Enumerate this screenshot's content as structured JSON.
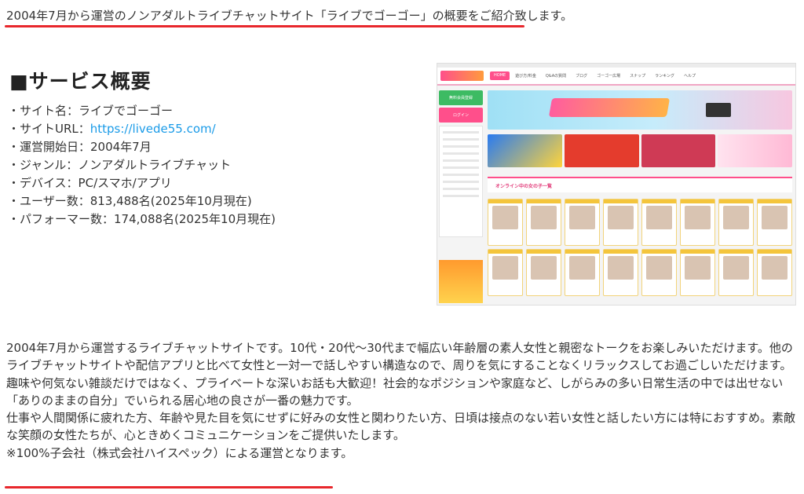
{
  "intro_text": "2004年7月から運営のノンアダルトライブチャットサイト「ライブでゴーゴー」の概要をご紹介致します。",
  "accent_color": "#e8272c",
  "link_color": "#1a9be8",
  "section_heading": "■サービス概要",
  "info": {
    "site_name": "・サイト名：ライブでゴーゴー",
    "site_url_label": "・サイトURL：",
    "site_url": "https://livede55.com/",
    "start_date": "・運営開始日：2004年7月",
    "genre": "・ジャンル：ノンアダルトライブチャット",
    "device": "・デバイス：PC/スマホ/アプリ",
    "users": "・ユーザー数：813,488名(2025年10月現在)",
    "performers": "・パフォーマー数：174,088名(2025年10月現在)"
  },
  "screenshot": {
    "nav": [
      "HOME",
      "遊び方/料金",
      "Q&Aの質問",
      "ブログ",
      "ゴーゴー広場",
      "スナップ",
      "ランキング",
      "ヘルプ"
    ],
    "signup_button": "無料会員登録",
    "login_button": "ログイン",
    "online_heading": "オンライン中の女の子一覧"
  },
  "description": [
    "2004年7月から運営するライブチャットサイトです。10代・20代～30代まで幅広い年齢層の素人女性と親密なトークをお楽しみいただけます。他のライブチャットサイトや配信アプリと比べて女性と一対一で話しやすい構造なので、周りを気にすることなくリラックスしてお過ごしいただけます。",
    "趣味や何気ない雑談だけではなく、プライベートな深いお話も大歓迎！社会的なポジションや家庭など、しがらみの多い日常生活の中では出せない「ありのままの自分」でいられる居心地の良さが一番の魅力です。",
    "仕事や人間関係に疲れた方、年齢や見た目を気にせずに好みの女性と関わりたい方、日頃は接点のない若い女性と話したい方には特におすすめ。素敵な笑顔の女性たちが、心ときめくコミュニケーションをご提供いたします。",
    "※100%子会社（株式会社ハイスペック）による運営となります。"
  ]
}
